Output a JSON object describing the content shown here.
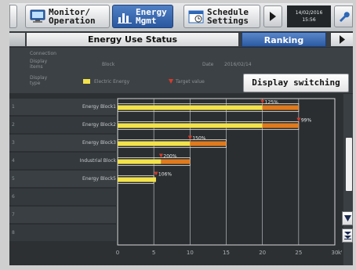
{
  "topbar": {
    "monitor_label": "Monitor/\nOperation",
    "energy_label": "Energy\nMgmt",
    "schedule_label": "Schedule\nSettings",
    "date": "14/02/2016",
    "time": "15:56",
    "icons": {
      "monitor": "monitor-icon",
      "energy": "bar-chart-icon",
      "schedule": "calendar-icon",
      "next": "play-right-icon",
      "settings": "wrench-icon"
    }
  },
  "tabs": {
    "status_label": "Energy Use Status",
    "ranking_label": "Ranking"
  },
  "info": {
    "connection_label": "Connection",
    "display_label": "Display\nitems",
    "display_value": "Block",
    "date_label": "Date",
    "date_value": "2016/02/14",
    "display_type_label": "Display\ntype",
    "legend_energy": "Electric Energy",
    "legend_target": "Target value",
    "display_switching": "Display switching"
  },
  "chart_data": {
    "type": "bar",
    "categories": [
      "Energy Block1",
      "Energy Block2",
      "Energy Block3",
      "Industrial Block",
      "Energy Block5"
    ],
    "row_numbers": [
      "1",
      "2",
      "3",
      "4",
      "5",
      "6",
      "7",
      "8"
    ],
    "values": [
      20,
      20,
      10,
      6,
      5.3
    ],
    "targets": [
      25,
      25,
      15,
      10,
      5
    ],
    "target_labels": [
      "125%",
      "99%",
      "150%",
      "200%",
      "106%"
    ],
    "xticks": [
      "0",
      "5",
      "10",
      "15",
      "20",
      "25",
      "30"
    ],
    "xlim": [
      0,
      30
    ],
    "xunit": "kW",
    "colors": {
      "energy": "#f3e24a",
      "over_target": "#e07a1c",
      "target_marker": "#d63b2a"
    }
  }
}
